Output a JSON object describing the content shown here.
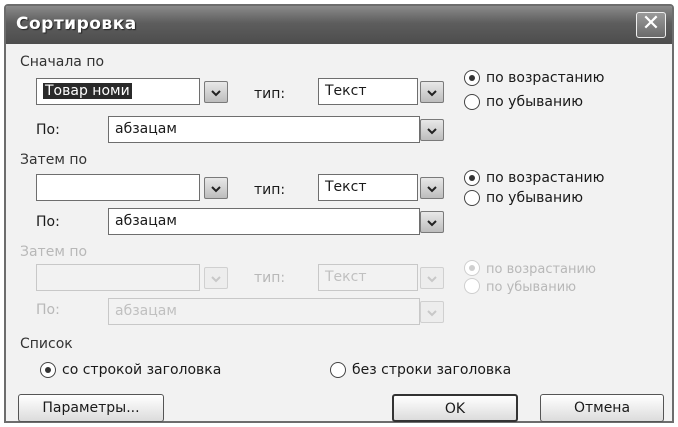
{
  "window": {
    "title": "Сортировка",
    "close_glyph": "✕"
  },
  "sort1": {
    "group_label": "Сначала по",
    "field_value": "Товар номи",
    "type_label": "тип:",
    "type_value": "Текст",
    "by_label": "По:",
    "by_value": "абзацам",
    "asc_label": "по возрастанию",
    "desc_label": "по убыванию",
    "selected": "asc"
  },
  "sort2": {
    "group_label": "Затем по",
    "field_value": "",
    "type_label": "тип:",
    "type_value": "Текст",
    "by_label": "По:",
    "by_value": "абзацам",
    "asc_label": "по возрастанию",
    "desc_label": "по убыванию",
    "selected": "asc"
  },
  "sort3": {
    "group_label": "Затем по",
    "field_value": "",
    "type_label": "тип:",
    "type_value": "Текст",
    "by_label": "По:",
    "by_value": "абзацам",
    "asc_label": "по возрастанию",
    "desc_label": "по убыванию",
    "selected": "asc",
    "enabled": false
  },
  "list": {
    "group_label": "Список",
    "with_header_label": "со строкой заголовка",
    "without_header_label": "без строки заголовка",
    "selected": "with_header"
  },
  "buttons": {
    "params": "Параметры...",
    "ok": "OK",
    "cancel": "Отмена"
  },
  "icons": {
    "dropdown": "chevron-down-icon",
    "close": "close-icon",
    "radio": "radio-icon"
  }
}
